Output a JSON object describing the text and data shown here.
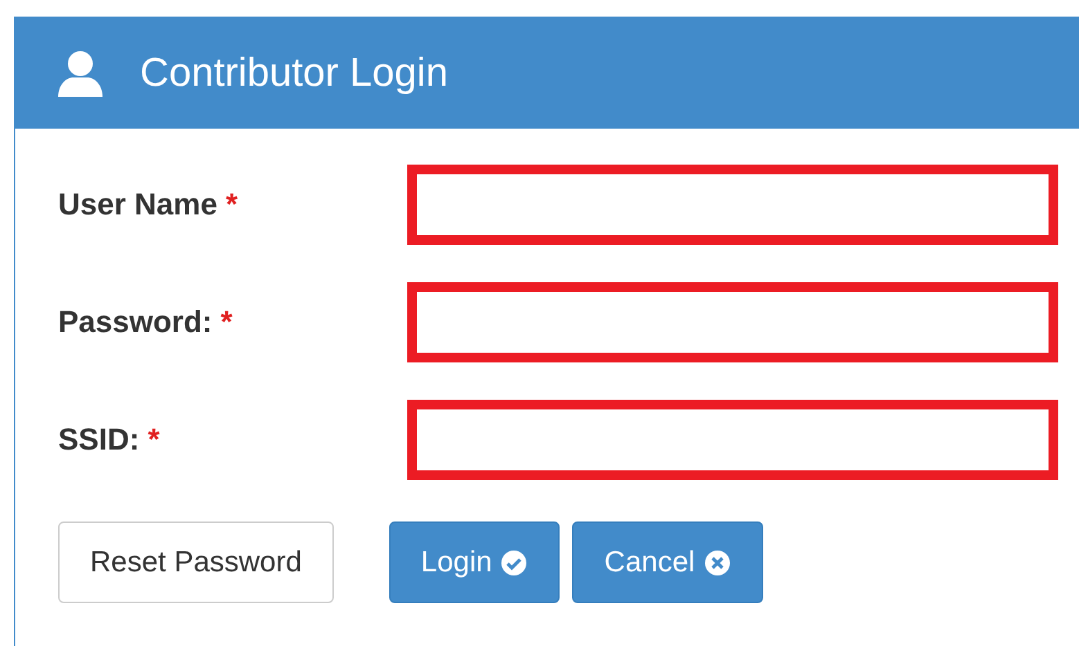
{
  "panel": {
    "title": "Contributor Login"
  },
  "fields": [
    {
      "label": "User Name",
      "required_mark": "*"
    },
    {
      "label": "Password:",
      "required_mark": "*"
    },
    {
      "label": "SSID:",
      "required_mark": "*"
    }
  ],
  "buttons": [
    {
      "kind": "plain",
      "label": "Reset Password"
    },
    {
      "kind": "confirm",
      "label": "Login"
    },
    {
      "kind": "cancel",
      "label": "Cancel"
    }
  ]
}
